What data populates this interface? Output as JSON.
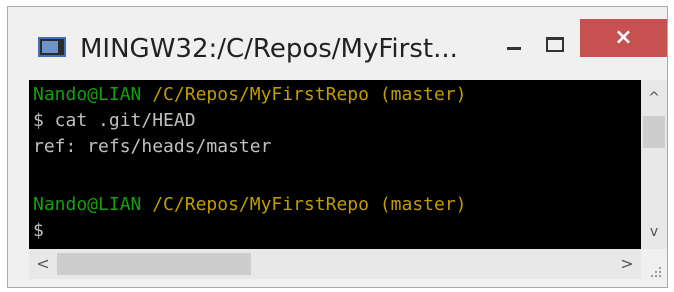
{
  "window": {
    "title": "MINGW32:/C/Repos/MyFirst...",
    "minimize_icon": "minimize-icon",
    "maximize_icon": "maximize-icon",
    "close_icon": "close-icon",
    "close_glyph": "×"
  },
  "terminal": {
    "lines": [
      {
        "user": "Nando@LIAN",
        "path": "/C/Repos/MyFirstRepo",
        "branch": "(master)"
      },
      {
        "text": "$ cat .git/HEAD"
      },
      {
        "text": "ref: refs/heads/master"
      },
      {
        "text": ""
      },
      {
        "user": "Nando@LIAN",
        "path": "/C/Repos/MyFirstRepo",
        "branch": "(master)"
      },
      {
        "text": "$"
      }
    ]
  },
  "scrollbars": {
    "up_arrow": "^",
    "down_arrow": "v",
    "left_arrow": "<",
    "right_arrow": ">"
  },
  "colors": {
    "user": "#13a10e",
    "path": "#c19c00",
    "text": "#c0c0c0",
    "close_button": "#c75050"
  }
}
